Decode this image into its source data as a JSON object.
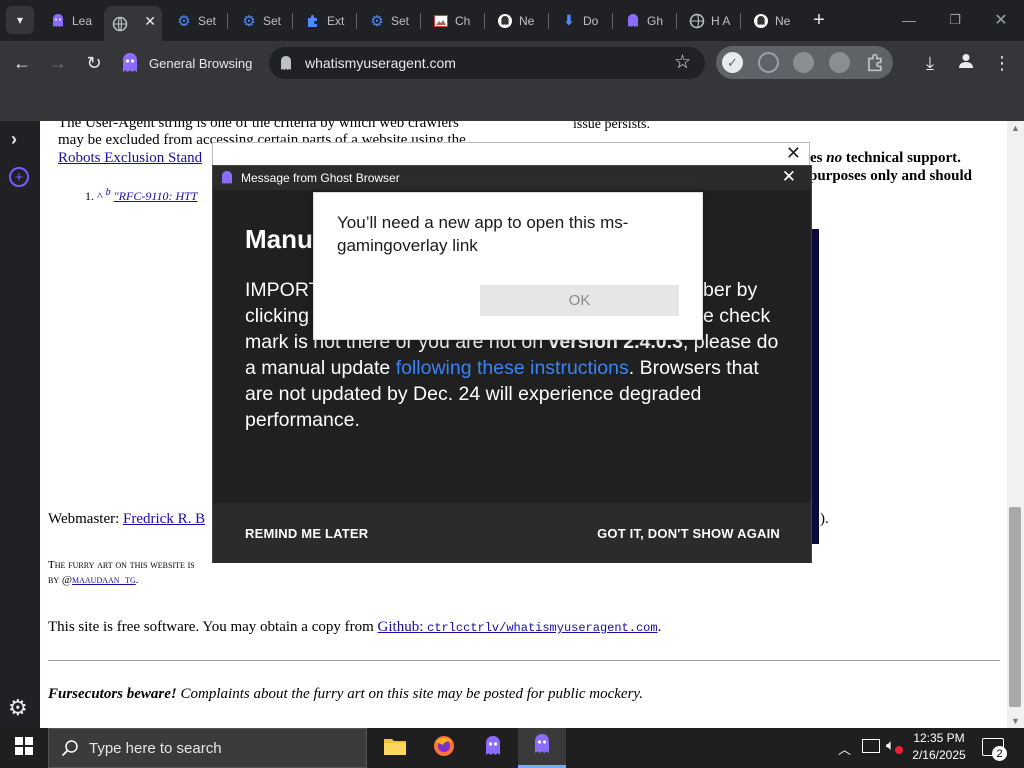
{
  "tabs": [
    {
      "label": "Lea",
      "icon": "ghost-icon"
    },
    {
      "label": "",
      "icon": "globe-icon",
      "active": true
    },
    {
      "label": "Set",
      "icon": "gear-icon"
    },
    {
      "label": "Set",
      "icon": "gear-icon"
    },
    {
      "label": "Ext",
      "icon": "puzzle-icon"
    },
    {
      "label": "Set",
      "icon": "gear-icon"
    },
    {
      "label": "Ch",
      "icon": "image-icon"
    },
    {
      "label": "Ne",
      "icon": "ghost-icon"
    },
    {
      "label": "Do",
      "icon": "download-icon"
    },
    {
      "label": "Gh",
      "icon": "ghost-icon"
    },
    {
      "label": "H A",
      "icon": "globe-icon"
    },
    {
      "label": "Ne",
      "icon": "ghost-icon"
    }
  ],
  "toolbar": {
    "profile_label": "General Browsing",
    "url": "whatismyuseragent.com"
  },
  "page": {
    "para1_line1": "The User-Agent string is one of the criteria by which web crawlers",
    "para1_line2": "may be excluded from accessing certain parts of a website using the",
    "robots_link": "Robots Exclusion Stand",
    "ref_caret": "^",
    "ref_b": "b",
    "ref_link": "\"RFC-9110: HTT",
    "right_text1": "issue persists.",
    "right_text2a": "es",
    "right_text2b": "no",
    "right_text2c": "technical support.",
    "right_text3": "purposes only and should",
    "webmaster_label": "Webmaster:",
    "webmaster_link": "Fredrick R. B",
    "webmaster_tail": ").",
    "furry_line1": "The furry art on this website is",
    "furry_line2a": "by @",
    "furry_link": "maaudaan_tg",
    "free_software": "This site is free software. You may obtain a copy from",
    "github_link_a": "Github:",
    "github_link_b": "ctrlcctrlv/whatismyuseragent.com",
    "fursecutors_bold": "Fursecutors beware!",
    "fursecutors_rest": "Complaints about the furry art on this site may be posted for public mockery."
  },
  "ghost_dialog": {
    "title": "Message from Ghost Browser",
    "heading": "Manu",
    "line1": "IMPORT",
    "line1_right": "ber by",
    "line2": "clicking",
    "line2_right": "e check",
    "line3_a": "mark is not there or you are not on",
    "line3_b": "version 2.4.0.3",
    "line3_c": ", please do",
    "line4_a": "a manual update",
    "line4_link": "following these instructions",
    "line4_c": ". Browsers that",
    "line5": "are not updated by Dec. 24 will experience degraded",
    "line6": "performance.",
    "remind_label": "REMIND ME LATER",
    "gotit_label": "GOT IT, DON'T SHOW AGAIN"
  },
  "app_dialog": {
    "message": "You’ll need a new app to open this ms-gamingoverlay link",
    "ok_label": "OK"
  },
  "taskbar": {
    "search_placeholder": "Type here to search",
    "time": "12:35 PM",
    "date": "2/16/2025",
    "notification_count": "2"
  },
  "colors": {
    "accent_link": "#1a0dab",
    "ghost_purple": "#7b5cff",
    "dialog_link": "#3b82f6"
  }
}
